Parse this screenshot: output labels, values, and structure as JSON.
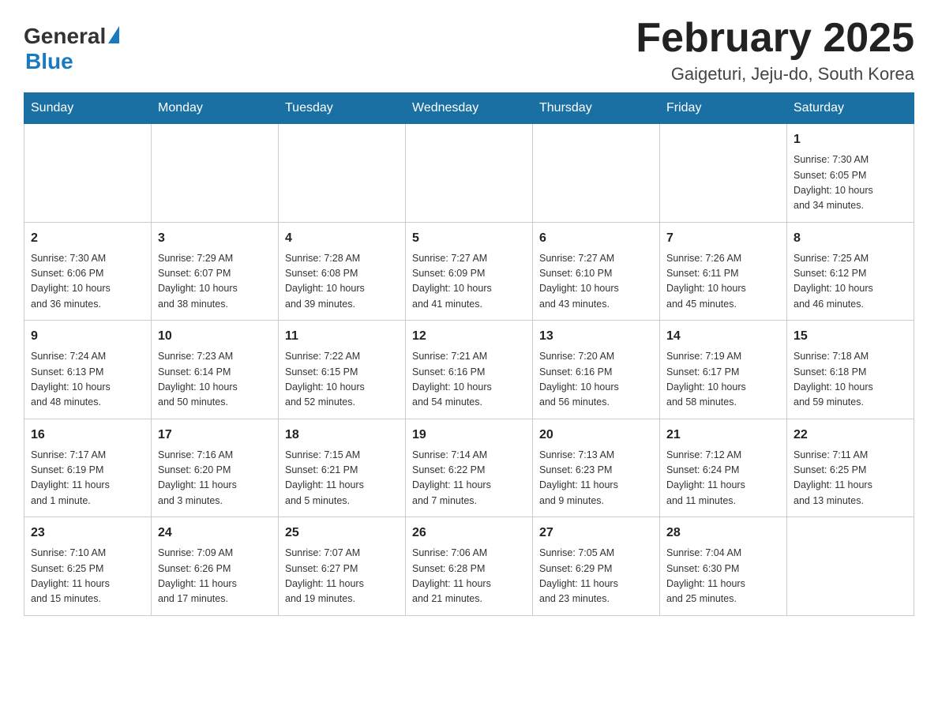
{
  "header": {
    "logo_general": "General",
    "logo_blue": "Blue",
    "title": "February 2025",
    "subtitle": "Gaigeturi, Jeju-do, South Korea"
  },
  "days_of_week": [
    "Sunday",
    "Monday",
    "Tuesday",
    "Wednesday",
    "Thursday",
    "Friday",
    "Saturday"
  ],
  "weeks": [
    {
      "days": [
        {
          "number": "",
          "info": ""
        },
        {
          "number": "",
          "info": ""
        },
        {
          "number": "",
          "info": ""
        },
        {
          "number": "",
          "info": ""
        },
        {
          "number": "",
          "info": ""
        },
        {
          "number": "",
          "info": ""
        },
        {
          "number": "1",
          "info": "Sunrise: 7:30 AM\nSunset: 6:05 PM\nDaylight: 10 hours\nand 34 minutes."
        }
      ]
    },
    {
      "days": [
        {
          "number": "2",
          "info": "Sunrise: 7:30 AM\nSunset: 6:06 PM\nDaylight: 10 hours\nand 36 minutes."
        },
        {
          "number": "3",
          "info": "Sunrise: 7:29 AM\nSunset: 6:07 PM\nDaylight: 10 hours\nand 38 minutes."
        },
        {
          "number": "4",
          "info": "Sunrise: 7:28 AM\nSunset: 6:08 PM\nDaylight: 10 hours\nand 39 minutes."
        },
        {
          "number": "5",
          "info": "Sunrise: 7:27 AM\nSunset: 6:09 PM\nDaylight: 10 hours\nand 41 minutes."
        },
        {
          "number": "6",
          "info": "Sunrise: 7:27 AM\nSunset: 6:10 PM\nDaylight: 10 hours\nand 43 minutes."
        },
        {
          "number": "7",
          "info": "Sunrise: 7:26 AM\nSunset: 6:11 PM\nDaylight: 10 hours\nand 45 minutes."
        },
        {
          "number": "8",
          "info": "Sunrise: 7:25 AM\nSunset: 6:12 PM\nDaylight: 10 hours\nand 46 minutes."
        }
      ]
    },
    {
      "days": [
        {
          "number": "9",
          "info": "Sunrise: 7:24 AM\nSunset: 6:13 PM\nDaylight: 10 hours\nand 48 minutes."
        },
        {
          "number": "10",
          "info": "Sunrise: 7:23 AM\nSunset: 6:14 PM\nDaylight: 10 hours\nand 50 minutes."
        },
        {
          "number": "11",
          "info": "Sunrise: 7:22 AM\nSunset: 6:15 PM\nDaylight: 10 hours\nand 52 minutes."
        },
        {
          "number": "12",
          "info": "Sunrise: 7:21 AM\nSunset: 6:16 PM\nDaylight: 10 hours\nand 54 minutes."
        },
        {
          "number": "13",
          "info": "Sunrise: 7:20 AM\nSunset: 6:16 PM\nDaylight: 10 hours\nand 56 minutes."
        },
        {
          "number": "14",
          "info": "Sunrise: 7:19 AM\nSunset: 6:17 PM\nDaylight: 10 hours\nand 58 minutes."
        },
        {
          "number": "15",
          "info": "Sunrise: 7:18 AM\nSunset: 6:18 PM\nDaylight: 10 hours\nand 59 minutes."
        }
      ]
    },
    {
      "days": [
        {
          "number": "16",
          "info": "Sunrise: 7:17 AM\nSunset: 6:19 PM\nDaylight: 11 hours\nand 1 minute."
        },
        {
          "number": "17",
          "info": "Sunrise: 7:16 AM\nSunset: 6:20 PM\nDaylight: 11 hours\nand 3 minutes."
        },
        {
          "number": "18",
          "info": "Sunrise: 7:15 AM\nSunset: 6:21 PM\nDaylight: 11 hours\nand 5 minutes."
        },
        {
          "number": "19",
          "info": "Sunrise: 7:14 AM\nSunset: 6:22 PM\nDaylight: 11 hours\nand 7 minutes."
        },
        {
          "number": "20",
          "info": "Sunrise: 7:13 AM\nSunset: 6:23 PM\nDaylight: 11 hours\nand 9 minutes."
        },
        {
          "number": "21",
          "info": "Sunrise: 7:12 AM\nSunset: 6:24 PM\nDaylight: 11 hours\nand 11 minutes."
        },
        {
          "number": "22",
          "info": "Sunrise: 7:11 AM\nSunset: 6:25 PM\nDaylight: 11 hours\nand 13 minutes."
        }
      ]
    },
    {
      "days": [
        {
          "number": "23",
          "info": "Sunrise: 7:10 AM\nSunset: 6:25 PM\nDaylight: 11 hours\nand 15 minutes."
        },
        {
          "number": "24",
          "info": "Sunrise: 7:09 AM\nSunset: 6:26 PM\nDaylight: 11 hours\nand 17 minutes."
        },
        {
          "number": "25",
          "info": "Sunrise: 7:07 AM\nSunset: 6:27 PM\nDaylight: 11 hours\nand 19 minutes."
        },
        {
          "number": "26",
          "info": "Sunrise: 7:06 AM\nSunset: 6:28 PM\nDaylight: 11 hours\nand 21 minutes."
        },
        {
          "number": "27",
          "info": "Sunrise: 7:05 AM\nSunset: 6:29 PM\nDaylight: 11 hours\nand 23 minutes."
        },
        {
          "number": "28",
          "info": "Sunrise: 7:04 AM\nSunset: 6:30 PM\nDaylight: 11 hours\nand 25 minutes."
        },
        {
          "number": "",
          "info": ""
        }
      ]
    }
  ]
}
